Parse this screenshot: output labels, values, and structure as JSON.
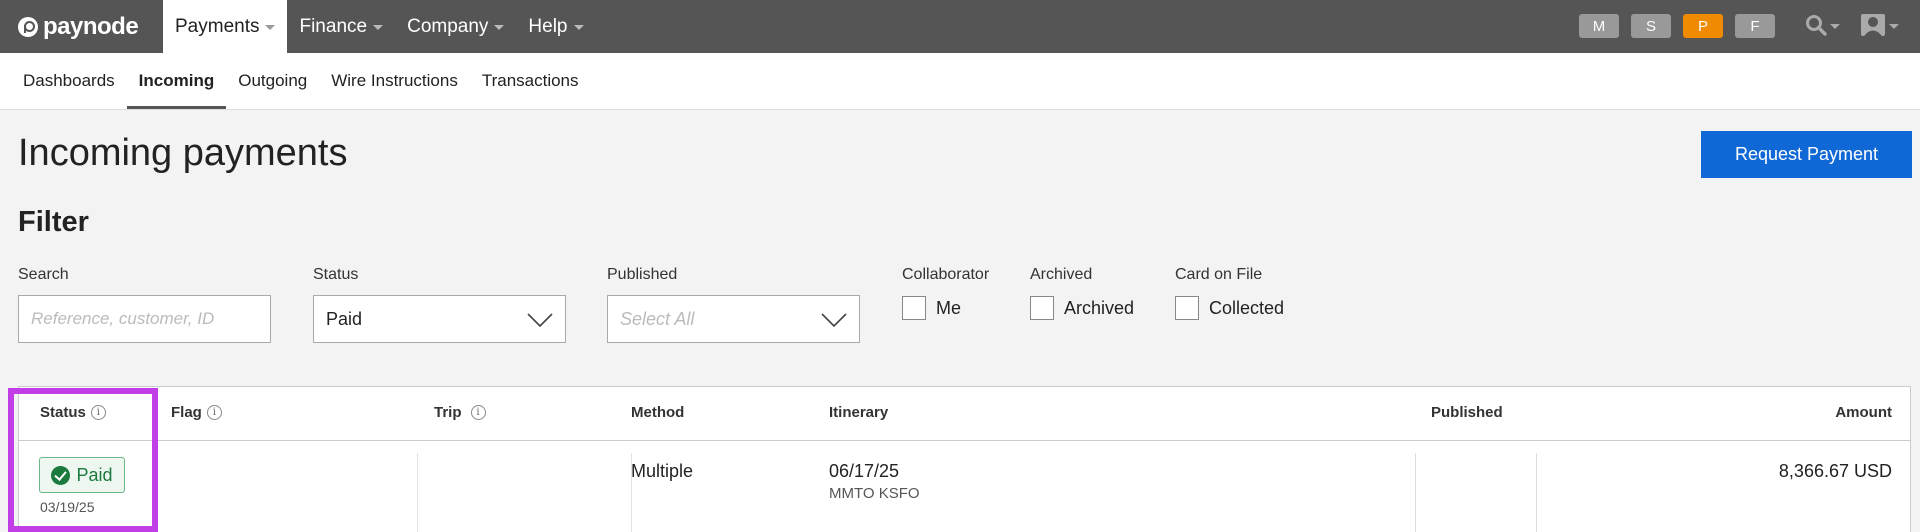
{
  "brand": {
    "name": "paynode"
  },
  "topnav": {
    "items": [
      {
        "label": "Payments",
        "active": true
      },
      {
        "label": "Finance",
        "active": false
      },
      {
        "label": "Company",
        "active": false
      },
      {
        "label": "Help",
        "active": false
      }
    ],
    "badges": [
      {
        "label": "M",
        "color": "#9a9a9a"
      },
      {
        "label": "S",
        "color": "#9a9a9a"
      },
      {
        "label": "P",
        "color": "#f08a00"
      },
      {
        "label": "F",
        "color": "#9a9a9a"
      }
    ],
    "icons": [
      "search-icon",
      "user-avatar-icon"
    ]
  },
  "subnav": {
    "items": [
      {
        "label": "Dashboards",
        "active": false
      },
      {
        "label": "Incoming",
        "active": true
      },
      {
        "label": "Outgoing",
        "active": false
      },
      {
        "label": "Wire Instructions",
        "active": false
      },
      {
        "label": "Transactions",
        "active": false
      }
    ]
  },
  "page": {
    "title": "Incoming payments",
    "request_button": "Request Payment"
  },
  "filter": {
    "title": "Filter",
    "search": {
      "label": "Search",
      "placeholder": "Reference, customer, ID"
    },
    "status": {
      "label": "Status",
      "value": "Paid"
    },
    "published": {
      "label": "Published",
      "placeholder": "Select All"
    },
    "collaborator": {
      "label": "Collaborator",
      "option": "Me",
      "checked": false
    },
    "archived": {
      "label": "Archived",
      "option": "Archived",
      "checked": false
    },
    "card_on_file": {
      "label": "Card on File",
      "option": "Collected",
      "checked": false
    }
  },
  "table": {
    "columns": {
      "status": "Status",
      "flag": "Flag",
      "trip": "Trip",
      "method": "Method",
      "itinerary": "Itinerary",
      "published": "Published",
      "amount": "Amount"
    },
    "rows": [
      {
        "status": "Paid",
        "status_date": "03/19/25",
        "method": "Multiple",
        "itinerary_date": "06/17/25",
        "itinerary_route": "MMTO KSFO",
        "amount": "8,366.67 USD"
      }
    ]
  },
  "colors": {
    "topbar": "#555555",
    "accent": "#1068d6",
    "paid_green": "#1b7a3e",
    "highlight": "#c13ee6"
  }
}
